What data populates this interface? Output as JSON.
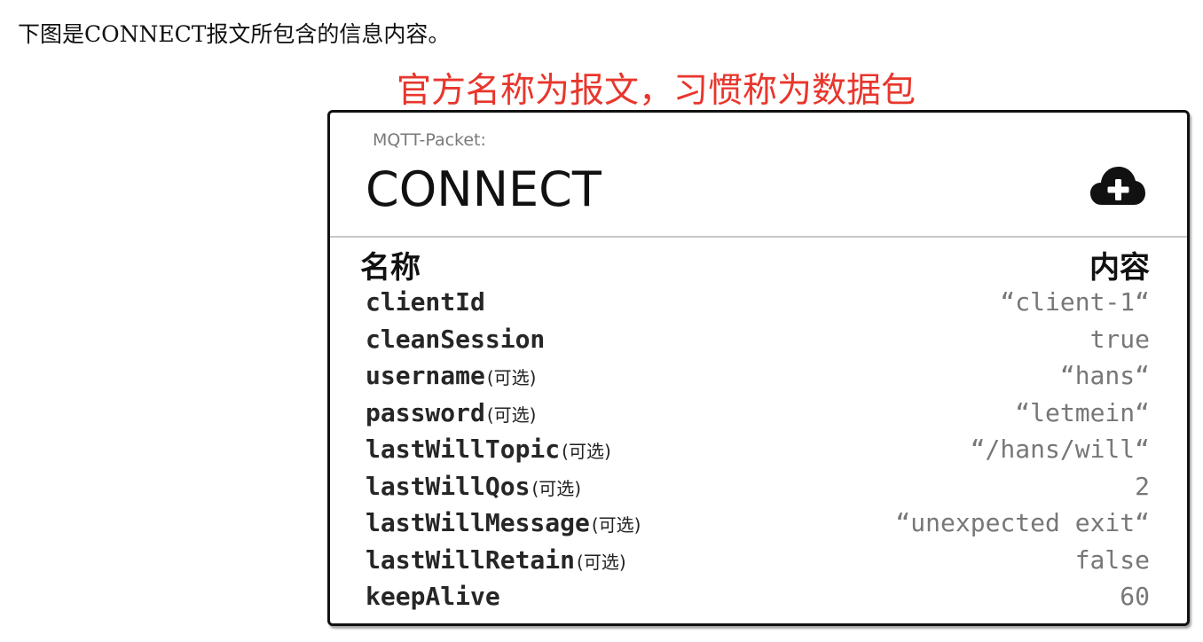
{
  "intro_text": "下图是CONNECT报文所包含的信息内容。",
  "annotation": "官方名称为报文，习惯称为数据包",
  "packet": {
    "kicker": "MQTT-Packet:",
    "title": "CONNECT",
    "icon": "cloud-plus-icon"
  },
  "table": {
    "name_header": "名称",
    "value_header": "内容",
    "rows": [
      {
        "name": "clientId",
        "tag": "",
        "value": "“client-1“"
      },
      {
        "name": "cleanSession",
        "tag": "",
        "value": "true"
      },
      {
        "name": "username",
        "tag": "(可选)",
        "value": "“hans“"
      },
      {
        "name": "password",
        "tag": "(可选)",
        "value": "“letmein“"
      },
      {
        "name": "lastWillTopic",
        "tag": "(可选)",
        "value": "“/hans/will“"
      },
      {
        "name": "lastWillQos",
        "tag": "(可选)",
        "value": "2"
      },
      {
        "name": "lastWillMessage",
        "tag": "(可选)",
        "value": "“unexpected exit“"
      },
      {
        "name": "lastWillRetain",
        "tag": "(可选)",
        "value": "false"
      },
      {
        "name": "keepAlive",
        "tag": "",
        "value": "60"
      }
    ]
  },
  "colors": {
    "annotation": "#e8362c",
    "value_text": "#777777"
  }
}
